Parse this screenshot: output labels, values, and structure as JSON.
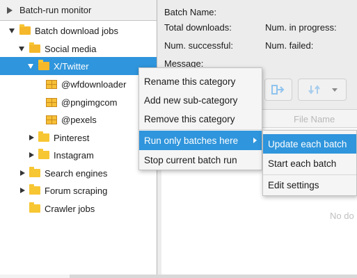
{
  "tree": {
    "header": "Batch-run monitor",
    "nodes": [
      {
        "label": "Batch download jobs"
      },
      {
        "label": "Social media"
      },
      {
        "label": "X/Twitter"
      },
      {
        "label": "@wfdownloader"
      },
      {
        "label": "@pngimgcom"
      },
      {
        "label": "@pexels"
      },
      {
        "label": "Pinterest"
      },
      {
        "label": "Instagram"
      },
      {
        "label": "Search engines"
      },
      {
        "label": "Forum scraping"
      },
      {
        "label": "Crawler jobs"
      }
    ]
  },
  "details": {
    "batch_name_label": "Batch Name:",
    "total_downloads_label": "Total downloads:",
    "in_progress_label": "Num. in progress:",
    "successful_label": "Num. successful:",
    "failed_label": "Num. failed:",
    "message_label": "Message:",
    "table_column_file_name": "File Name",
    "empty_text": "No do"
  },
  "context_menu": {
    "items": [
      {
        "label": "Rename this category"
      },
      {
        "label": "Add new sub-category"
      },
      {
        "label": "Remove this category"
      },
      {
        "label": "Run only batches here"
      },
      {
        "label": "Stop current batch run"
      }
    ]
  },
  "submenu": {
    "items": [
      {
        "label": "Update each batch"
      },
      {
        "label": "Start each batch"
      },
      {
        "label": "Edit settings"
      }
    ]
  },
  "colors": {
    "selection": "#2f95dc",
    "folder": "#f7c633"
  }
}
